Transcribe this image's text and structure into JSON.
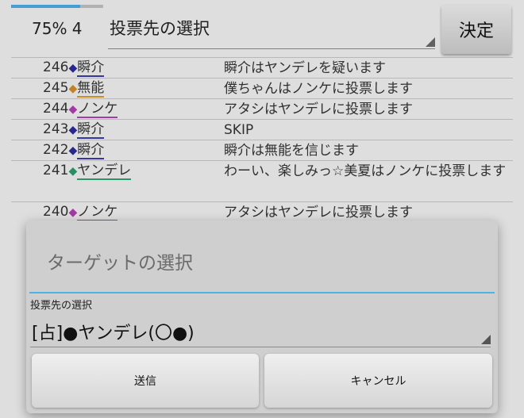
{
  "header": {
    "progress_percent": 75,
    "progress_text": "75% 4",
    "vote_select_label": "投票先の選択",
    "decide_label": "決定"
  },
  "log": [
    {
      "num": "246",
      "diamond_color": "#2a2a9a",
      "name": "瞬介",
      "underline": "#3a3aa8",
      "message": "瞬介はヤンデレを疑います"
    },
    {
      "num": "245",
      "diamond_color": "#d08a2a",
      "name": "無能",
      "underline": "#d8962e",
      "message": "僕ちゃんはノンケに投票します"
    },
    {
      "num": "244",
      "diamond_color": "#b03cb0",
      "name": "ノンケ",
      "underline": "#b040b0",
      "message": "アタシはヤンデレに投票します"
    },
    {
      "num": "243",
      "diamond_color": "#2a2a9a",
      "name": "瞬介",
      "underline": "#3a3aa8",
      "message": "SKIP"
    },
    {
      "num": "242",
      "diamond_color": "#2a2a9a",
      "name": "瞬介",
      "underline": "#3a3aa8",
      "message": "瞬介は無能を信じます"
    },
    {
      "num": "241",
      "diamond_color": "#2a9a6a",
      "name": "ヤンデレ",
      "underline": "#2e9e70",
      "message": "わーい、楽しみっ☆美夏はノンケに投票します"
    },
    {
      "num": "240",
      "diamond_color": "#b03cb0",
      "name": "ノンケ",
      "underline": "#b040b0",
      "message": "アタシはヤンデレに投票します"
    }
  ],
  "modal": {
    "title": "ターゲットの選択",
    "field_label": "投票先の選択",
    "selected_value": "[占]●ヤンデレ(〇●)",
    "send_label": "送信",
    "cancel_label": "キャンセル"
  }
}
